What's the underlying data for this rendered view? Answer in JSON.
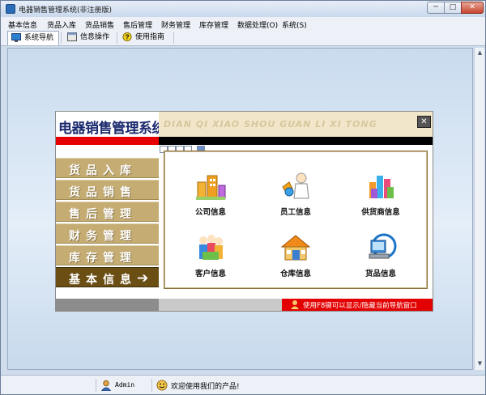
{
  "window": {
    "title": "电器销售管理系统(非注册版)",
    "min_glyph": "─",
    "max_glyph": "□",
    "close_glyph": "✕"
  },
  "menu": {
    "items": [
      "基本信息",
      "货品入库",
      "货品销售",
      "售后管理",
      "财务管理",
      "库存管理",
      "数据处理(O)",
      "系统(S)"
    ]
  },
  "tabs": [
    {
      "label": "系统导航",
      "icon": "monitor-icon",
      "active": true
    },
    {
      "label": "信息操作",
      "icon": "window-icon",
      "active": false
    },
    {
      "label": "使用指南",
      "icon": "help-icon",
      "active": false
    }
  ],
  "nav_panel": {
    "title": "电器销售管理系统",
    "pinyin": "DIAN QI XIAO SHOU GUAN LI XI TONG",
    "close_glyph": "✕",
    "progress": {
      "total": 5,
      "filled": 1
    },
    "menu": [
      {
        "label": "货品入库",
        "selected": false
      },
      {
        "label": "货品销售",
        "selected": false
      },
      {
        "label": "售后管理",
        "selected": false
      },
      {
        "label": "财务管理",
        "selected": false
      },
      {
        "label": "库存管理",
        "selected": false
      },
      {
        "label": "基本信息",
        "selected": true
      }
    ],
    "selected_arrow": "➔",
    "items": [
      {
        "label": "公司信息",
        "icon": "company-icon"
      },
      {
        "label": "员工信息",
        "icon": "employee-icon"
      },
      {
        "label": "供货商信息",
        "icon": "supplier-icon"
      },
      {
        "label": "客户信息",
        "icon": "customer-icon"
      },
      {
        "label": "仓库信息",
        "icon": "warehouse-icon"
      },
      {
        "label": "货品信息",
        "icon": "product-icon"
      }
    ],
    "tip": "使用F8键可以显示/隐藏当前导航窗口"
  },
  "status": {
    "user": "Admin",
    "message": "欢迎使用我们的产品!"
  },
  "colors": {
    "nav_item_bg": "#c4ac73",
    "nav_item_selected_bg": "#6a4e14",
    "title_blue": "#1b2a6e",
    "red": "#e60000"
  }
}
